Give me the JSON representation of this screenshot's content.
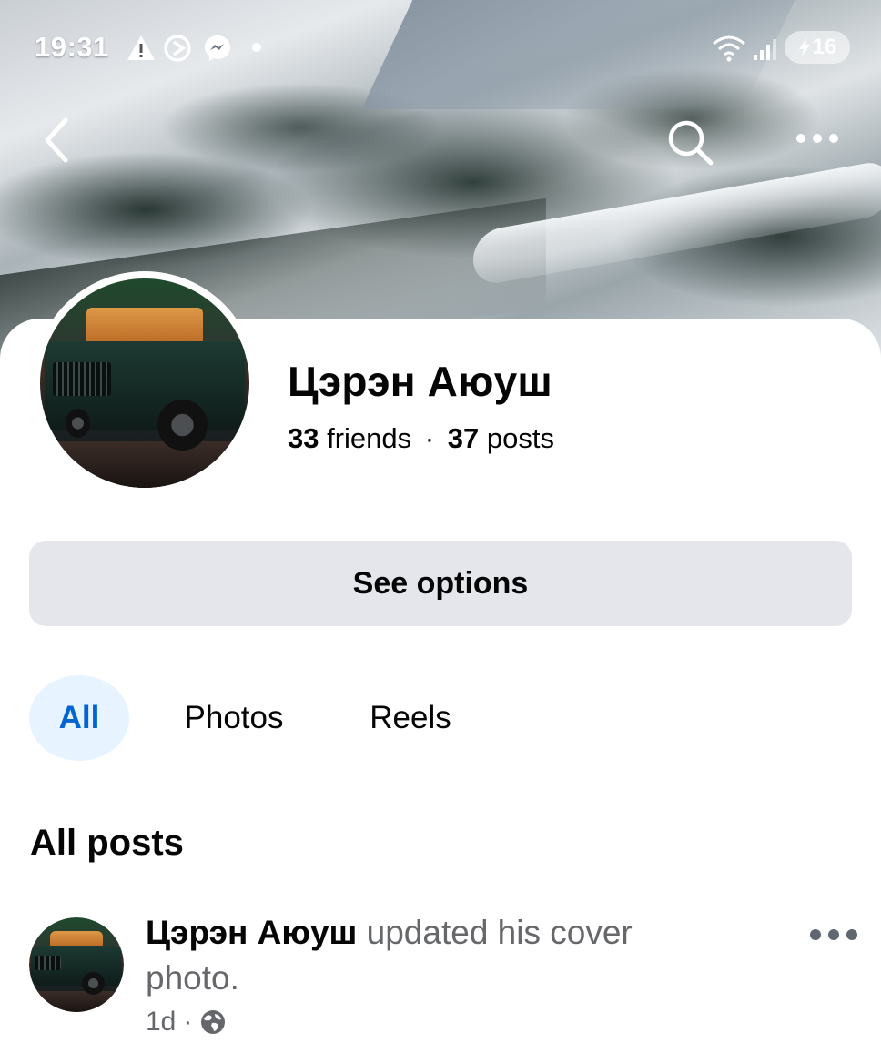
{
  "status_bar": {
    "time": "19:31",
    "battery_level": "16",
    "icons": [
      "warning-icon",
      "data-saver-icon",
      "messenger-icon",
      "notification-dot-icon",
      "wifi-icon",
      "cell-signal-icon",
      "charging-bolt-icon"
    ]
  },
  "top_nav": {
    "icons": [
      "back-chevron-icon",
      "search-icon",
      "more-dots-icon"
    ]
  },
  "profile": {
    "name": "Цэрэн Аюуш",
    "friends_count": "33",
    "friends_label": "friends",
    "separator": "·",
    "posts_count": "37",
    "posts_label": "posts"
  },
  "actions": {
    "see_options_label": "See options"
  },
  "tabs": [
    {
      "label": "All",
      "selected": true
    },
    {
      "label": "Photos",
      "selected": false
    },
    {
      "label": "Reels",
      "selected": false
    }
  ],
  "feed": {
    "section_title": "All posts",
    "posts": [
      {
        "author": "Цэрэн Аюуш",
        "action": "updated his cover photo.",
        "time": "1d",
        "separator": "·",
        "privacy_icon": "globe-icon"
      }
    ]
  },
  "colors": {
    "accent": "#0064d1",
    "tab_selected_bg": "#e7f3ff",
    "button_bg": "#e4e6eb",
    "secondary_text": "#65676b"
  }
}
